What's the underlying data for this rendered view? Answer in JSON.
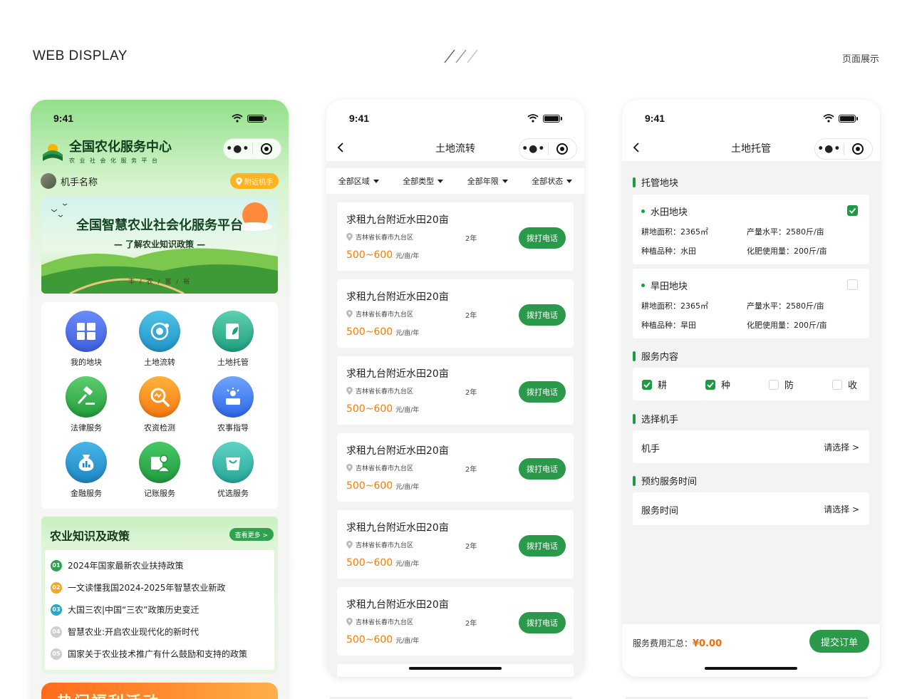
{
  "header": {
    "left": "WEB DISPLAY",
    "right": "页面展示"
  },
  "status": {
    "time": "9:41"
  },
  "colors": {
    "primary_green": "#2a9a4a",
    "price_orange": "#ff7a00",
    "accent_yellow": "#ffb320"
  },
  "phone1": {
    "brand_title": "全国农化服务中心",
    "brand_sub": "农业社会化服务平台",
    "user_name": "机手名称",
    "nearby_btn": "附近机手",
    "banner": {
      "title": "全国智慧农业社会化服务平台",
      "subtitle": "— 了解农业知识政策 —",
      "footer": "丰 / 农 / 富 / 裕"
    },
    "grid": [
      {
        "label": "我的地块",
        "icon": "plots-icon"
      },
      {
        "label": "土地流转",
        "icon": "transfer-icon"
      },
      {
        "label": "土地托管",
        "icon": "trust-icon"
      },
      {
        "label": "法律服务",
        "icon": "gavel-icon"
      },
      {
        "label": "农资检测",
        "icon": "inspect-icon"
      },
      {
        "label": "农事指导",
        "icon": "guide-icon"
      },
      {
        "label": "金融服务",
        "icon": "finance-icon"
      },
      {
        "label": "记账服务",
        "icon": "ledger-icon"
      },
      {
        "label": "优选服务",
        "icon": "shop-icon"
      }
    ],
    "news": {
      "title": "农业知识及政策",
      "more": "查看更多 >",
      "items": [
        {
          "num": "01",
          "text": "2024年国家最新农业扶持政策",
          "color": "#2fa24e"
        },
        {
          "num": "02",
          "text": "一文读懂我国2024-2025年智慧农业新政",
          "color": "#f5a623"
        },
        {
          "num": "03",
          "text": "大国三农|中国“三农”政策历史变迁",
          "color": "#2aa6c8"
        },
        {
          "num": "04",
          "text": "智慧农业:开启农业现代化的新时代",
          "color": "#cfcfcf"
        },
        {
          "num": "05",
          "text": "国家关于农业技术推广有什么鼓励和支持的政策",
          "color": "#cfcfcf"
        }
      ]
    },
    "promo": "热门福利活动"
  },
  "phone2": {
    "title": "土地流转",
    "filters": [
      "全部区域",
      "全部类型",
      "全部年限",
      "全部状态"
    ],
    "listings": [
      {
        "title": "求租九台附近水田20亩",
        "location": "吉林省长春市九台区",
        "term": "2年",
        "price": "500~600",
        "unit": "元/亩/年",
        "button": "拨打电话"
      },
      {
        "title": "求租九台附近水田20亩",
        "location": "吉林省长春市九台区",
        "term": "2年",
        "price": "500~600",
        "unit": "元/亩/年",
        "button": "拨打电话"
      },
      {
        "title": "求租九台附近水田20亩",
        "location": "吉林省长春市九台区",
        "term": "2年",
        "price": "500~600",
        "unit": "元/亩/年",
        "button": "拨打电话"
      },
      {
        "title": "求租九台附近水田20亩",
        "location": "吉林省长春市九台区",
        "term": "2年",
        "price": "500~600",
        "unit": "元/亩/年",
        "button": "拨打电话"
      },
      {
        "title": "求租九台附近水田20亩",
        "location": "吉林省长春市九台区",
        "term": "2年",
        "price": "500~600",
        "unit": "元/亩/年",
        "button": "拨打电话"
      },
      {
        "title": "求租九台附近水田20亩",
        "location": "吉林省长春市九台区",
        "term": "2年",
        "price": "500~600",
        "unit": "元/亩/年",
        "button": "拨打电话"
      }
    ]
  },
  "phone3": {
    "title": "土地托管",
    "sec_plots": "托管地块",
    "plots": [
      {
        "name": "水田地块",
        "checked": true,
        "area": "耕地面积：2365㎡",
        "yield": "产量水平：2580斤/亩",
        "crop": "种植品种：水田",
        "fert": "化肥使用量：200斤/亩"
      },
      {
        "name": "旱田地块",
        "checked": false,
        "area": "耕地面积：2365㎡",
        "yield": "产量水平：2580斤/亩",
        "crop": "种植品种：旱田",
        "fert": "化肥使用量：200斤/亩"
      }
    ],
    "sec_service": "服务内容",
    "services": [
      {
        "label": "耕",
        "checked": true
      },
      {
        "label": "种",
        "checked": true
      },
      {
        "label": "防",
        "checked": false
      },
      {
        "label": "收",
        "checked": false
      }
    ],
    "sec_operator": "选择机手",
    "operator": {
      "label": "机手",
      "value": "请选择 >"
    },
    "sec_time": "预约服务时间",
    "time": {
      "label": "服务时间",
      "value": "请选择 >"
    },
    "fee_label": "服务费用汇总：",
    "fee_value": "¥0.00",
    "submit": "提交订单"
  }
}
